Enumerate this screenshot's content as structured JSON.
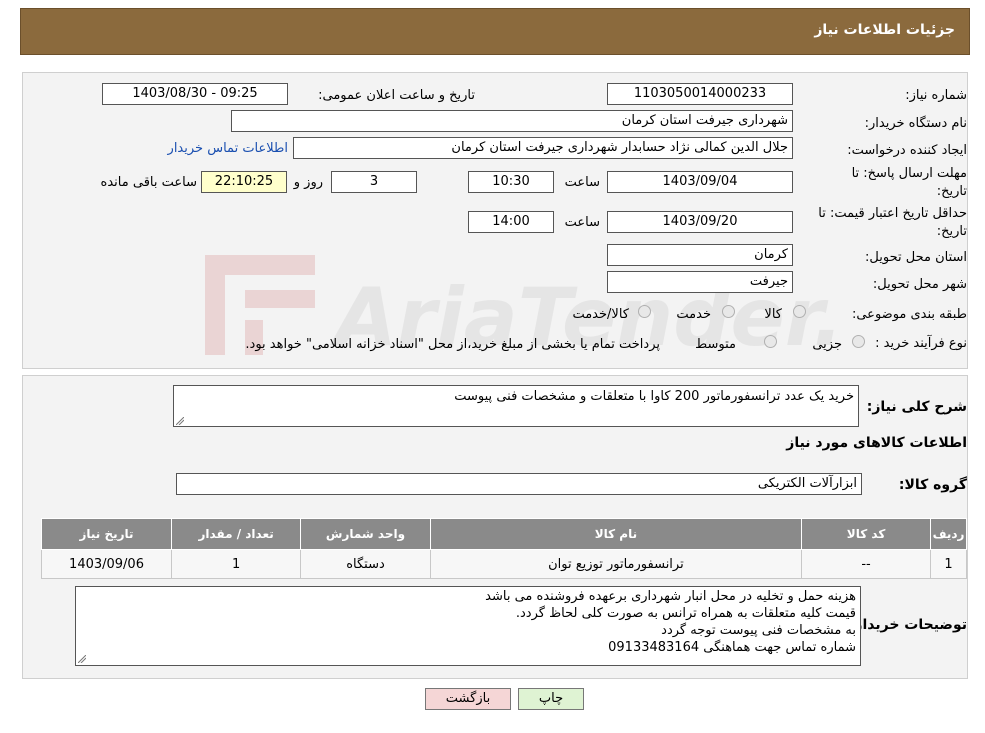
{
  "header": {
    "title": "جزئیات اطلاعات نیاز"
  },
  "form": {
    "need_number_label": "شماره نیاز:",
    "need_number": "1103050014000233",
    "announce_label": "تاریخ و ساعت اعلان عمومی:",
    "announce_value": "1403/08/30 - 09:25",
    "buyer_org_label": "نام دستگاه خریدار:",
    "buyer_org": "شهرداری جیرفت استان کرمان",
    "creator_label": "ایجاد کننده درخواست:",
    "creator": "جلال الدین کمالی نژاد حسابدار شهرداری جیرفت استان کرمان",
    "contact_link": "اطلاعات تماس خریدار",
    "deadline_label_1": "مهلت ارسال پاسخ: تا",
    "deadline_label_2": "تاریخ:",
    "deadline_date": "1403/09/04",
    "time_word": "ساعت",
    "deadline_time": "10:30",
    "days_value": "3",
    "days_word": "روز و",
    "remaining_time": "22:10:25",
    "remaining_word": "ساعت باقی مانده",
    "validity_label_1": "حداقل تاریخ اعتبار قیمت: تا",
    "validity_label_2": "تاریخ:",
    "validity_date": "1403/09/20",
    "validity_time": "14:00",
    "province_label": "استان محل تحویل:",
    "province": "کرمان",
    "city_label": "شهر محل تحویل:",
    "city": "جیرفت",
    "category_label": "طبقه بندی موضوعی:",
    "category_options": [
      "کالا",
      "خدمت",
      "کالا/خدمت"
    ],
    "process_label": "نوع فرآیند خرید :",
    "process_options": [
      "جزیی",
      "متوسط"
    ],
    "process_note": "پرداخت تمام یا بخشی از مبلغ خرید،از محل \"اسناد خزانه اسلامی\" خواهد بود."
  },
  "summary": {
    "desc_label": "شرح کلی نیاز:",
    "desc_value": "خرید یک عدد ترانسفورماتور 200 کاوا با متعلقات و مشخصات فنی پیوست",
    "goods_info_title": "اطلاعات کالاهای مورد نیاز",
    "group_label": "گروه کالا:",
    "group_value": "ابزارآلات الکتریکی"
  },
  "table": {
    "headers": [
      "ردیف",
      "کد کالا",
      "نام کالا",
      "واحد شمارش",
      "تعداد / مقدار",
      "تاریخ نیاز"
    ],
    "rows": [
      {
        "row": "1",
        "code": "--",
        "name": "ترانسفورماتور توزیع توان",
        "unit": "دستگاه",
        "qty": "1",
        "date": "1403/09/06"
      }
    ]
  },
  "notes": {
    "label": "توضیحات خریدار:",
    "lines": [
      "هزینه حمل و تخلیه در محل انبار شهرداری برعهده فروشنده می باشد",
      "قیمت کلیه متعلقات به همراه ترانس به صورت کلی لحاظ گردد.",
      "به مشخصات فنی پیوست توجه گردد",
      "شماره تماس جهت هماهنگی 09133483164"
    ]
  },
  "buttons": {
    "print": "چاپ",
    "back": "بازگشت"
  },
  "watermark": {
    "text": "AriaTender.neT"
  },
  "colors": {
    "header": "#8b6a3d",
    "table_header": "#8a8a8a",
    "link": "#1a4fb0",
    "back_button": "#f5d6d6",
    "print_button": "#dff3d3"
  }
}
